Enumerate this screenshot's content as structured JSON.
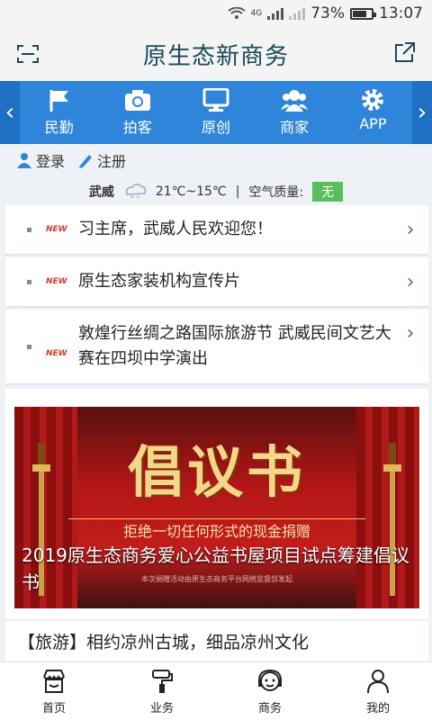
{
  "status": {
    "battery": "73%",
    "time": "13:07",
    "network": "4G"
  },
  "header": {
    "title": "原生态新商务",
    "left_icon": "scan-icon",
    "right_icon": "share-icon"
  },
  "nav": {
    "items": [
      {
        "label": "民勤",
        "icon": "flag-icon"
      },
      {
        "label": "拍客",
        "icon": "camera-icon"
      },
      {
        "label": "原创",
        "icon": "monitor-icon"
      },
      {
        "label": "商家",
        "icon": "users-icon"
      },
      {
        "label": "APP",
        "icon": "gear-icon"
      }
    ]
  },
  "auth": {
    "login": "登录",
    "register": "注册"
  },
  "weather": {
    "city": "武威",
    "temp": "21℃~15℃",
    "sep": "|",
    "aq_label": "空气质量:",
    "aq_value": "无"
  },
  "news": [
    {
      "tag": "NEW",
      "title": "习主席，武威人民欢迎您！"
    },
    {
      "tag": "NEW",
      "title": "原生态家装机构宣传片"
    },
    {
      "tag": "NEW",
      "title": "敦煌行丝绸之路国际旅游节 武威民间文艺大赛在四坝中学演出"
    }
  ],
  "banner": {
    "headline": "倡议书",
    "subline": "拒绝一切任何形式的现金捐赠",
    "caption": "2019原生态商务爱心公益书屋项目试点筹建倡议书",
    "fineprint": "本次捐赠活动由原生态商务平台网络监督部发起"
  },
  "travel": {
    "text": "【旅游】相约凉州古城，细品凉州文化"
  },
  "tabs": [
    {
      "label": "首页",
      "icon": "store-icon"
    },
    {
      "label": "业务",
      "icon": "paint-roller-icon"
    },
    {
      "label": "商务",
      "icon": "headset-icon"
    },
    {
      "label": "我的",
      "icon": "person-icon"
    }
  ],
  "colors": {
    "accent": "#2f85d9",
    "title": "#1b4a5a",
    "new": "#d23a2a",
    "aq": "#5cbd5c"
  }
}
